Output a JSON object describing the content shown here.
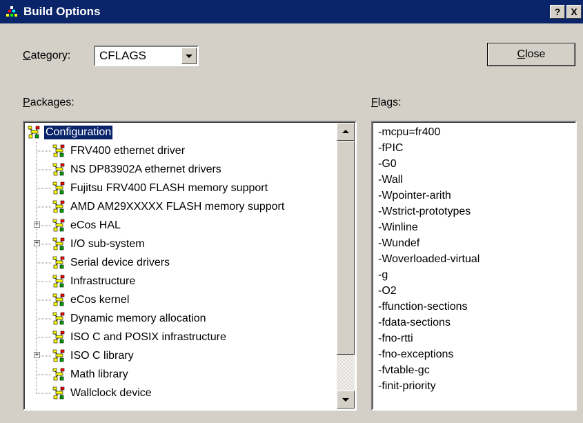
{
  "window": {
    "title": "Build Options",
    "help_label": "?",
    "close_label": "X"
  },
  "category": {
    "label": "Category:",
    "mnemonic": "C",
    "label_rest": "ategory:",
    "value": "CFLAGS"
  },
  "close_button": {
    "mnemonic": "C",
    "label_rest": "lose"
  },
  "packages": {
    "mnemonic": "P",
    "label_rest": "ackages:",
    "items": [
      {
        "label": "Configuration",
        "level": 0,
        "expander": "",
        "selected": true
      },
      {
        "label": "FRV400 ethernet driver",
        "level": 1,
        "expander": ""
      },
      {
        "label": "NS DP83902A ethernet drivers",
        "level": 1,
        "expander": ""
      },
      {
        "label": "Fujitsu FRV400 FLASH memory support",
        "level": 1,
        "expander": ""
      },
      {
        "label": "AMD AM29XXXXX FLASH memory support",
        "level": 1,
        "expander": ""
      },
      {
        "label": "eCos HAL",
        "level": 1,
        "expander": "+"
      },
      {
        "label": "I/O sub-system",
        "level": 1,
        "expander": "+"
      },
      {
        "label": "Serial device drivers",
        "level": 1,
        "expander": ""
      },
      {
        "label": "Infrastructure",
        "level": 1,
        "expander": ""
      },
      {
        "label": "eCos kernel",
        "level": 1,
        "expander": ""
      },
      {
        "label": "Dynamic memory allocation",
        "level": 1,
        "expander": ""
      },
      {
        "label": "ISO C and POSIX infrastructure",
        "level": 1,
        "expander": ""
      },
      {
        "label": "ISO C library",
        "level": 1,
        "expander": "+"
      },
      {
        "label": "Math library",
        "level": 1,
        "expander": ""
      },
      {
        "label": "Wallclock device",
        "level": 1,
        "expander": ""
      }
    ]
  },
  "flags": {
    "mnemonic": "F",
    "label_rest": "lags:",
    "items": [
      "-mcpu=fr400",
      "-fPIC",
      "-G0",
      "-Wall",
      "-Wpointer-arith",
      "-Wstrict-prototypes",
      "-Winline",
      "-Wundef",
      "-Woverloaded-virtual",
      "-g",
      "-O2",
      "-ffunction-sections",
      "-fdata-sections",
      "-fno-rtti",
      "-fno-exceptions",
      "-fvtable-gc",
      "-finit-priority"
    ]
  },
  "colors": {
    "titlebar": "#0a246a",
    "face": "#d4d0c8",
    "selection": "#0a246a"
  }
}
